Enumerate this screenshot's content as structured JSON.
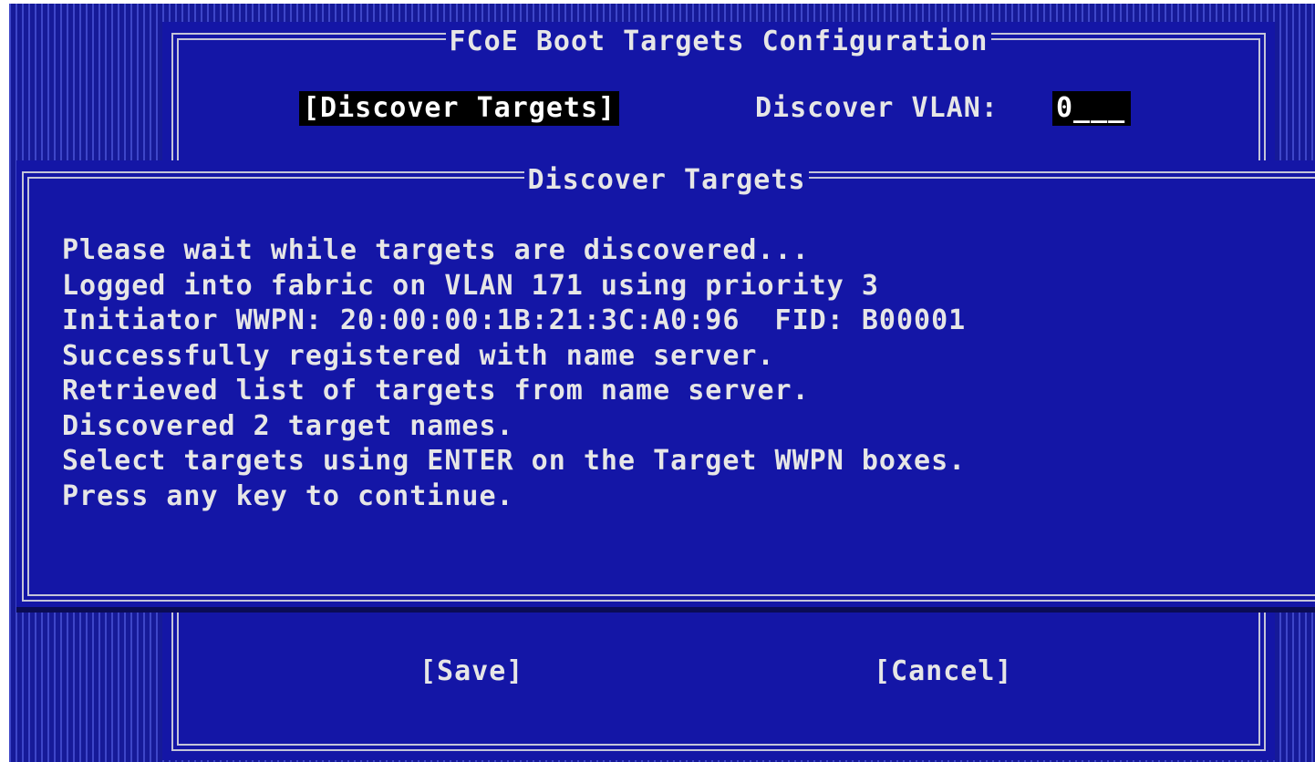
{
  "config_panel": {
    "title": "FCoE Boot Targets Configuration",
    "discover_button": "[Discover Targets]",
    "vlan_label": "Discover VLAN:",
    "vlan_value": "0___",
    "save_button": "[Save]",
    "cancel_button": "[Cancel]"
  },
  "dialog": {
    "title": "Discover Targets",
    "lines": [
      "Please wait while targets are discovered...",
      "Logged into fabric on VLAN 171 using priority 3",
      "Initiator WWPN: 20:00:00:1B:21:3C:A0:96  FID: B00001",
      "Successfully registered with name server.",
      "Retrieved list of targets from name server.",
      "Discovered 2 target names.",
      "Select targets using ENTER on the Target WWPN boxes.",
      "Press any key to continue."
    ]
  },
  "colors": {
    "panel_background": "#1416a6",
    "text": "#e6e6e6",
    "highlight_background": "#000000",
    "border": "#c4c4d8"
  }
}
